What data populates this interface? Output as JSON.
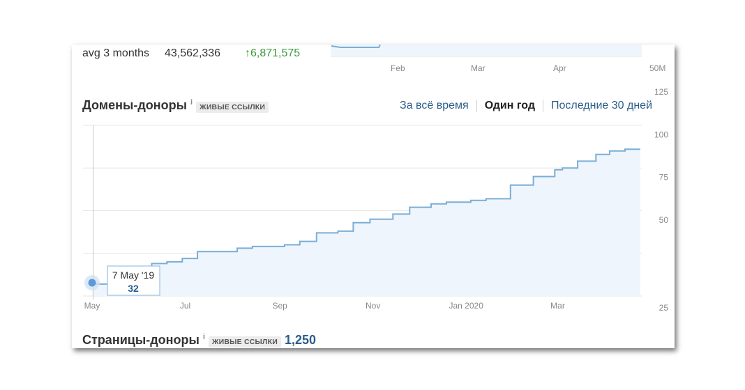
{
  "top_summary": {
    "label": "avg 3 months",
    "value": "43,562,336",
    "change": "↑6,871,575",
    "axis_labels": [
      "Feb",
      "Mar",
      "Apr"
    ],
    "axis_right": "50M"
  },
  "section": {
    "title": "Домены-доноры",
    "info": "i",
    "badge": "ЖИВЫЕ ССЫЛКИ",
    "tabs": [
      {
        "label": "За всё время",
        "active": false
      },
      {
        "label": "Один год",
        "active": true
      },
      {
        "label": "Последние 30 дней",
        "active": false
      }
    ]
  },
  "tooltip": {
    "date": "7 May '19",
    "value": "32"
  },
  "pages_section": {
    "title": "Страницы-доноры",
    "info": "i",
    "badge": "ЖИВЫЕ ССЫЛКИ",
    "value": "1,250"
  },
  "colors": {
    "line": "#7aaed6",
    "fill": "#eef5fc",
    "accent_text": "#2a5d8a",
    "positive": "#3a9a3a"
  },
  "chart_data": {
    "type": "area",
    "x_tick_labels": [
      "May",
      "Jul",
      "Sep",
      "Nov",
      "Jan 2020",
      "Mar"
    ],
    "y_tick_labels": [
      "25",
      "50",
      "75",
      "100",
      "125"
    ],
    "ylim": [
      25,
      125
    ],
    "grid": true,
    "series": [
      {
        "x": [
          "2019-05-07",
          "2019-05-20",
          "2019-06-01",
          "2019-06-15",
          "2019-06-25",
          "2019-07-05",
          "2019-07-15",
          "2019-07-22",
          "2019-08-10",
          "2019-08-20",
          "2019-09-10",
          "2019-09-20",
          "2019-10-01",
          "2019-10-15",
          "2019-10-25",
          "2019-11-05",
          "2019-11-20",
          "2019-12-01",
          "2019-12-15",
          "2019-12-25",
          "2020-01-10",
          "2020-01-20",
          "2020-02-05",
          "2020-02-20",
          "2020-03-05",
          "2020-03-10",
          "2020-03-20",
          "2020-04-01",
          "2020-04-10",
          "2020-04-20",
          "2020-04-30"
        ],
        "y": [
          32,
          35,
          40,
          44,
          45,
          47,
          51,
          51,
          53,
          54,
          55,
          57,
          62,
          63,
          68,
          70,
          73,
          77,
          79,
          80,
          81,
          82,
          90,
          95,
          99,
          100,
          104,
          108,
          110,
          111,
          111
        ]
      }
    ]
  }
}
